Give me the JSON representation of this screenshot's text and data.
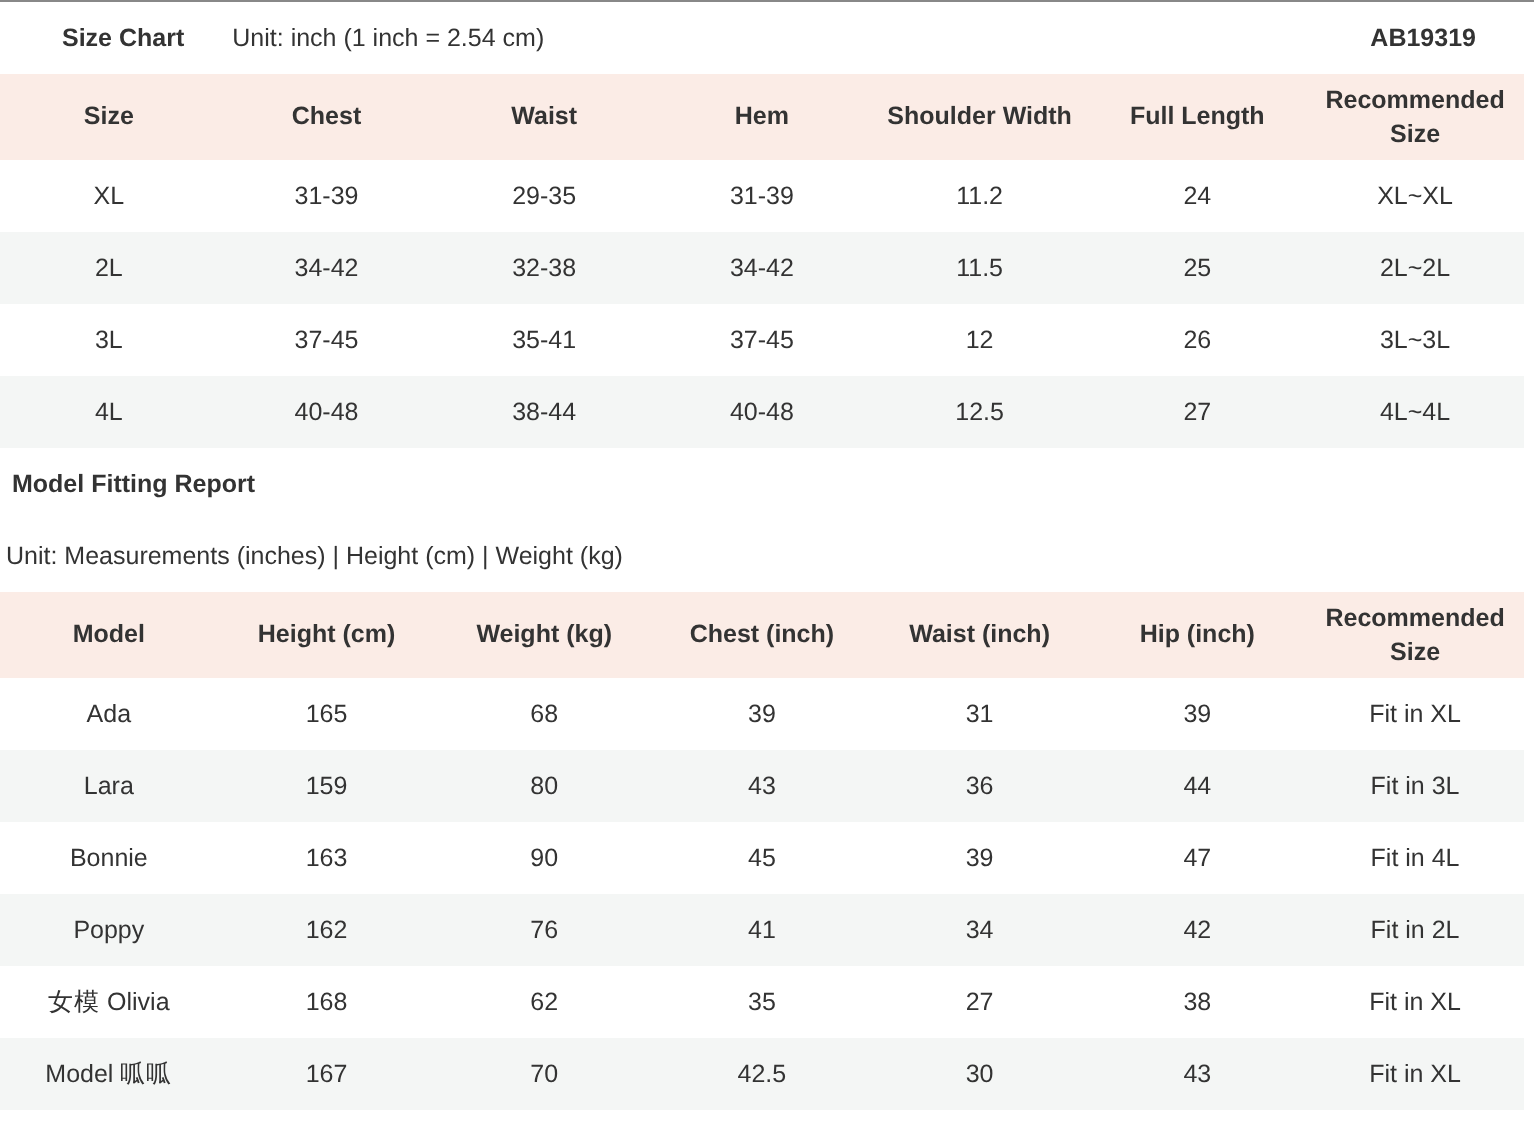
{
  "size_chart": {
    "title": "Size Chart",
    "unit": "Unit: inch (1 inch = 2.54 cm)",
    "code": "AB19319",
    "columns": [
      "Size",
      "Chest",
      "Waist",
      "Hem",
      "Shoulder Width",
      "Full Length",
      "Recommended Size"
    ],
    "rows": [
      [
        "XL",
        "31-39",
        "29-35",
        "31-39",
        "11.2",
        "24",
        "XL~XL"
      ],
      [
        "2L",
        "34-42",
        "32-38",
        "34-42",
        "11.5",
        "25",
        "2L~2L"
      ],
      [
        "3L",
        "37-45",
        "35-41",
        "37-45",
        "12",
        "26",
        "3L~3L"
      ],
      [
        "4L",
        "40-48",
        "38-44",
        "40-48",
        "12.5",
        "27",
        "4L~4L"
      ]
    ]
  },
  "model_report": {
    "title": "Model Fitting Report",
    "unit": "Unit: Measurements (inches) | Height (cm) | Weight (kg)",
    "columns": [
      "Model",
      "Height (cm)",
      "Weight (kg)",
      "Chest (inch)",
      "Waist (inch)",
      "Hip (inch)",
      "Recommended Size"
    ],
    "rows": [
      [
        "Ada",
        "165",
        "68",
        "39",
        "31",
        "39",
        "Fit in XL"
      ],
      [
        "Lara",
        "159",
        "80",
        "43",
        "36",
        "44",
        "Fit in 3L"
      ],
      [
        "Bonnie",
        "163",
        "90",
        "45",
        "39",
        "47",
        "Fit in 4L"
      ],
      [
        "Poppy",
        "162",
        "76",
        "41",
        "34",
        "42",
        "Fit in 2L"
      ],
      [
        "女模 Olivia",
        "168",
        "62",
        "35",
        "27",
        "38",
        "Fit in XL"
      ],
      [
        "Model 呱呱",
        "167",
        "70",
        "42.5",
        "30",
        "43",
        "Fit in XL"
      ]
    ]
  }
}
